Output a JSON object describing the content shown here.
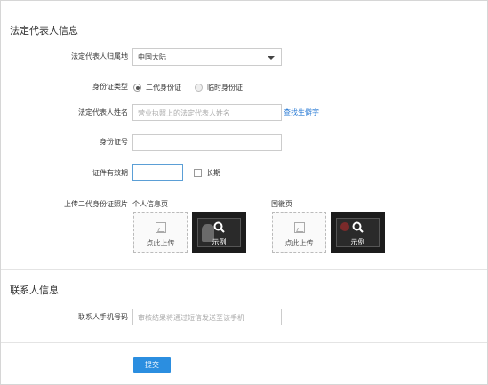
{
  "legal_rep": {
    "section_title": "法定代表人信息",
    "region_label": "法定代表人归属地",
    "region_value": "中国大陆",
    "id_type_label": "身份证类型",
    "id_type_options": [
      "二代身份证",
      "临时身份证"
    ],
    "name_label": "法定代表人姓名",
    "name_placeholder": "营业执照上的法定代表人姓名",
    "rare_char_link": "查找生僻字",
    "id_number_label": "身份证号",
    "validity_label": "证件有效期",
    "long_term_label": "长期",
    "upload_label": "上传二代身份证照片",
    "personal_page_label": "个人信息页",
    "emblem_page_label": "国徽页",
    "click_upload": "点此上传",
    "sample_label": "示例"
  },
  "contact": {
    "section_title": "联系人信息",
    "phone_label": "联系人手机号码",
    "phone_placeholder": "审核结果将通过短信发送至该手机"
  },
  "submit_label": "提交",
  "colors": {
    "accent": "#2b8ee0",
    "link": "#2a7bd5"
  }
}
